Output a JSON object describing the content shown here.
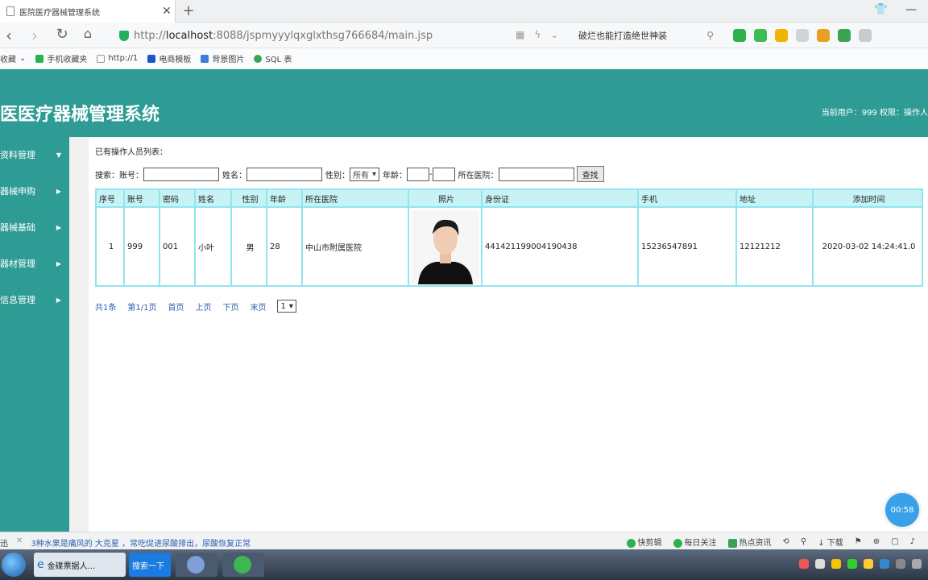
{
  "browser": {
    "tab_title": "医院医疗器械管理系统",
    "url_prefix": "http://",
    "url_host": "localhost",
    "url_rest": ":8088/jspmyyylqxglxthsg766684/main.jsp",
    "search_text": "破烂也能打造绝世神装",
    "bookmarks": [
      "收藏",
      "手机收藏夹",
      "http://1",
      "电商模板",
      "背景图片",
      "SQL 表"
    ]
  },
  "header": {
    "title": "医医疗器械管理系统",
    "user_info": "当前用户：999  权限：操作人"
  },
  "sidebar": {
    "items": [
      {
        "label": "资料管理"
      },
      {
        "label": "器械申购"
      },
      {
        "label": "器械基础"
      },
      {
        "label": "器材管理"
      },
      {
        "label": "信息管理"
      }
    ]
  },
  "main": {
    "list_title": "已有操作人员列表：",
    "search": {
      "prefix": "搜索：",
      "account_label": "账号：",
      "name_label": "姓名：",
      "gender_label": "性别：",
      "gender_value": "所有",
      "age_label": "年龄：",
      "age_sep": "-",
      "hospital_label": "所在医院：",
      "button": "查找"
    },
    "table": {
      "headers": [
        "序号",
        "账号",
        "密码",
        "姓名",
        "性别",
        "年龄",
        "所在医院",
        "照片",
        "身份证",
        "手机",
        "地址",
        "添加时间"
      ],
      "rows": [
        {
          "index": "1",
          "account": "999",
          "password": "001",
          "name": "小叶",
          "gender": "男",
          "age": "28",
          "hospital": "中山市附属医院",
          "id_card": "441421199004190438",
          "phone": "15236547891",
          "address": "12121212",
          "added": "2020-03-02 14:24:41.0"
        }
      ]
    },
    "pager": {
      "total": "共1条",
      "page": "第1/1页",
      "first": "首页",
      "prev": "上页",
      "next": "下页",
      "last": "末页",
      "select_value": "1"
    }
  },
  "timer": "00:58",
  "statusbar": {
    "left_first": "迅",
    "news": "3种水果是痛风的 大克星 ，常吃促进尿酸排出，尿酸恢复正常",
    "right": [
      "快剪辑",
      "每日关注",
      "热点资讯",
      "下载"
    ]
  },
  "taskbar": {
    "task1": "金碟票据人...",
    "task2": "搜索一下"
  },
  "colors": {
    "accent": "#2e9c95",
    "table_border": "#8fe6ee",
    "table_header": "#c8f3f6",
    "link": "#2b5fb0"
  }
}
